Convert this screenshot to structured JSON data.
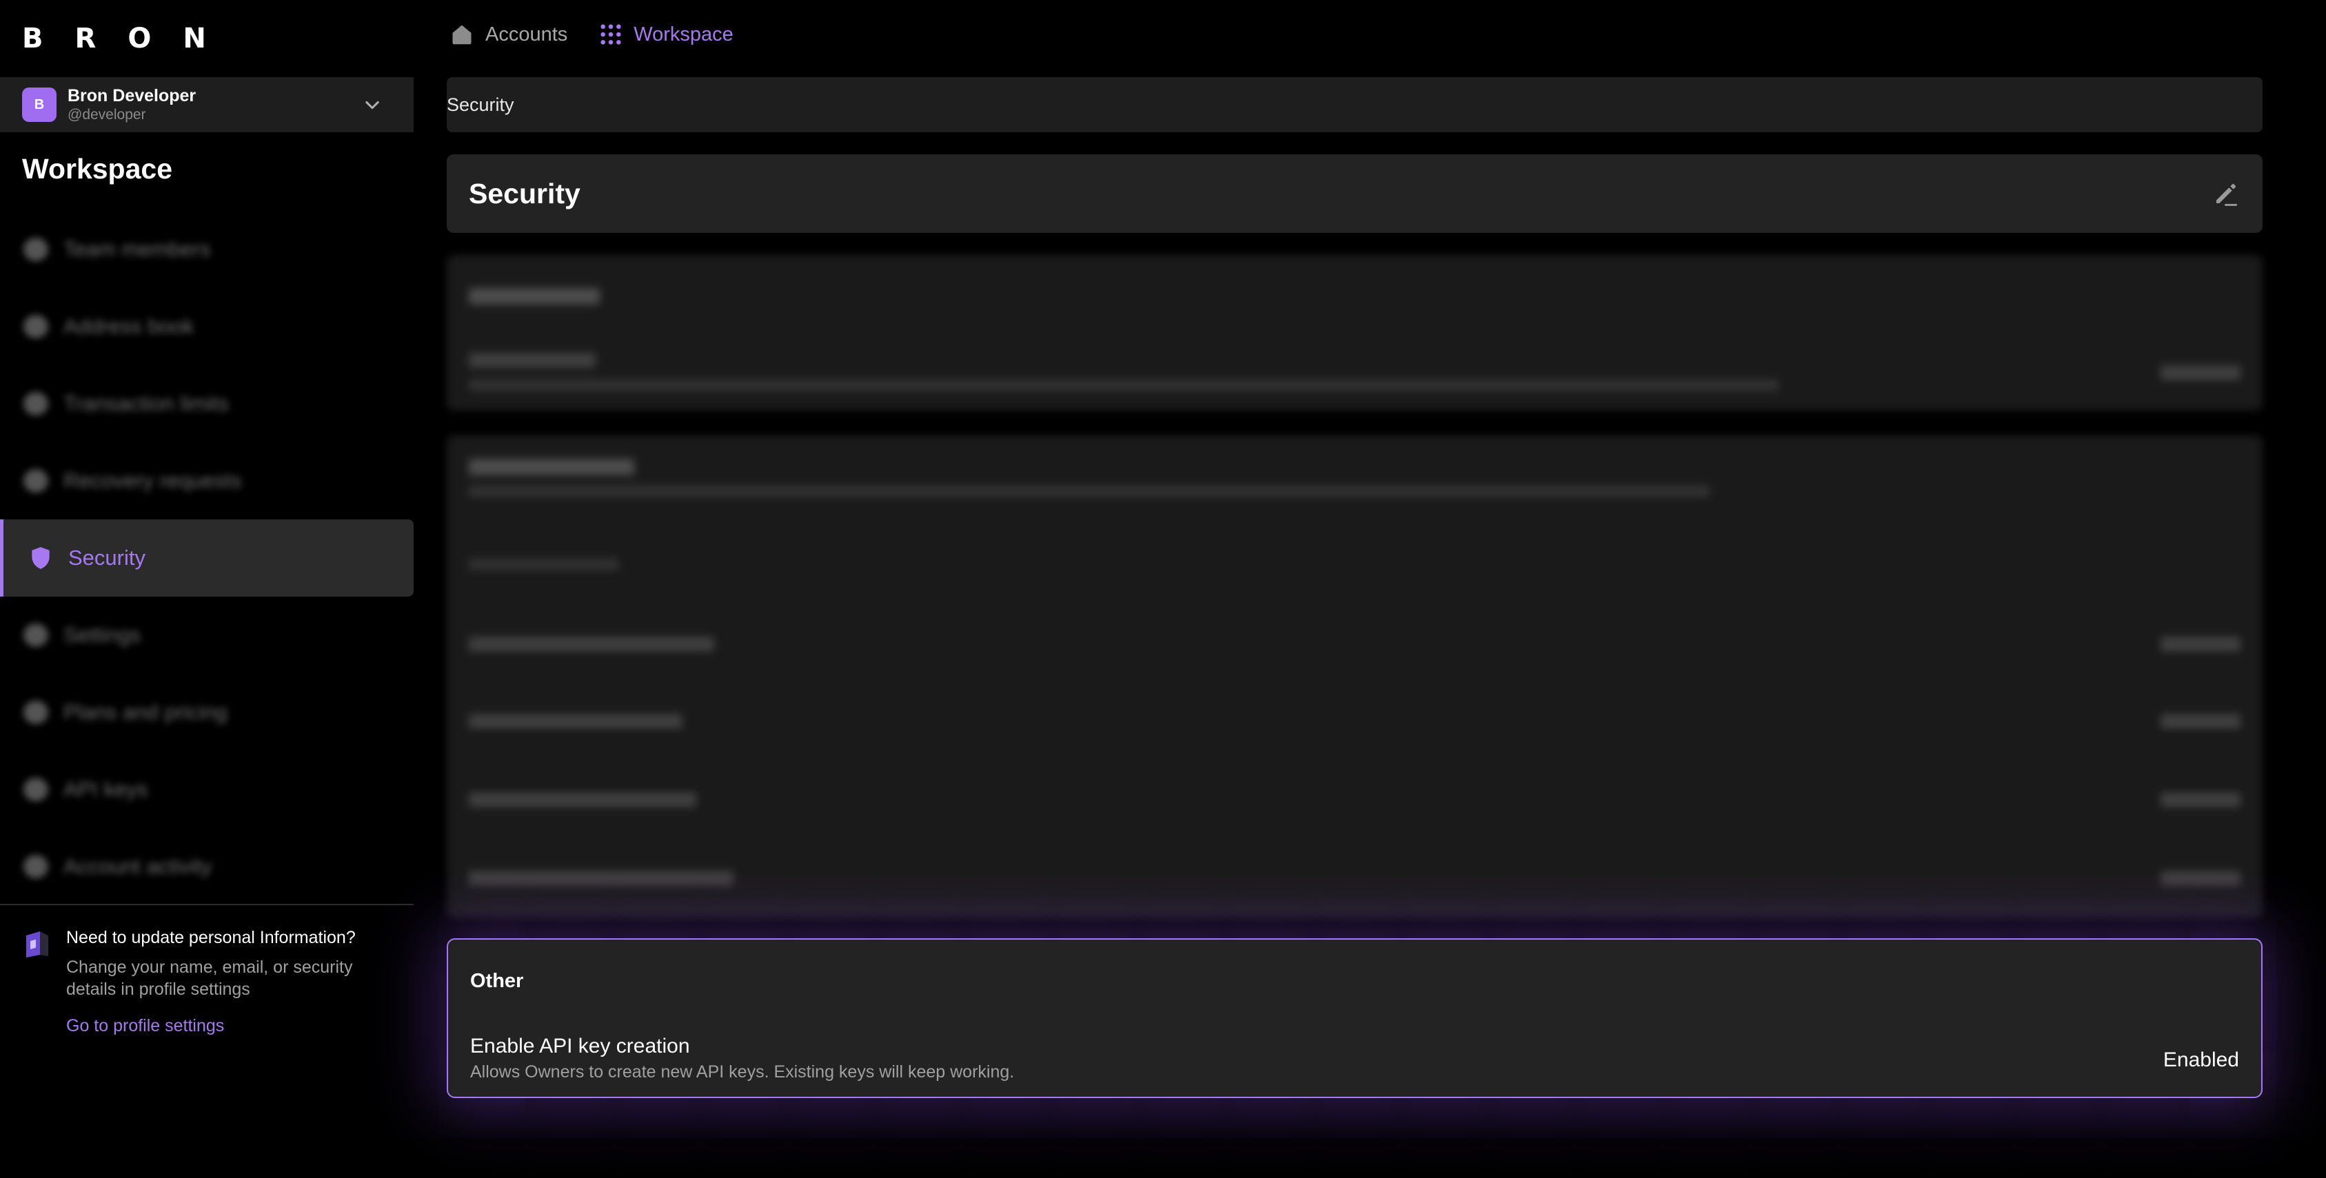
{
  "logo": {
    "letters": [
      "B",
      "R",
      "O",
      "N"
    ]
  },
  "topnav": {
    "accounts": "Accounts",
    "workspace": "Workspace"
  },
  "user": {
    "initial": "B",
    "name": "Bron Developer",
    "handle": "@developer"
  },
  "sidebar": {
    "title": "Workspace",
    "items": [
      {
        "label": "Team members",
        "icon": "team-icon"
      },
      {
        "label": "Address book",
        "icon": "address-book-icon"
      },
      {
        "label": "Transaction limits",
        "icon": "limits-icon"
      },
      {
        "label": "Recovery requests",
        "icon": "recovery-icon"
      },
      {
        "label": "Security",
        "icon": "shield-icon",
        "active": true
      },
      {
        "label": "Settings",
        "icon": "settings-icon"
      },
      {
        "label": "Plans and pricing",
        "icon": "pricing-icon"
      },
      {
        "label": "API keys",
        "icon": "key-icon"
      },
      {
        "label": "Account activity",
        "icon": "activity-icon"
      }
    ],
    "help": {
      "title": "Need to update personal Information?",
      "description": "Change your name, email, or security details in profile settings",
      "link": "Go to profile settings"
    }
  },
  "breadcrumb": "Security",
  "page_title": "Security",
  "other_section": {
    "title": "Other",
    "setting_label": "Enable API key creation",
    "setting_description": "Allows Owners to create new API keys. Existing keys will keep working.",
    "setting_value": "Enabled"
  },
  "colors": {
    "accent": "#a779f0",
    "background": "#000000",
    "surface": "#1f1f1f"
  }
}
